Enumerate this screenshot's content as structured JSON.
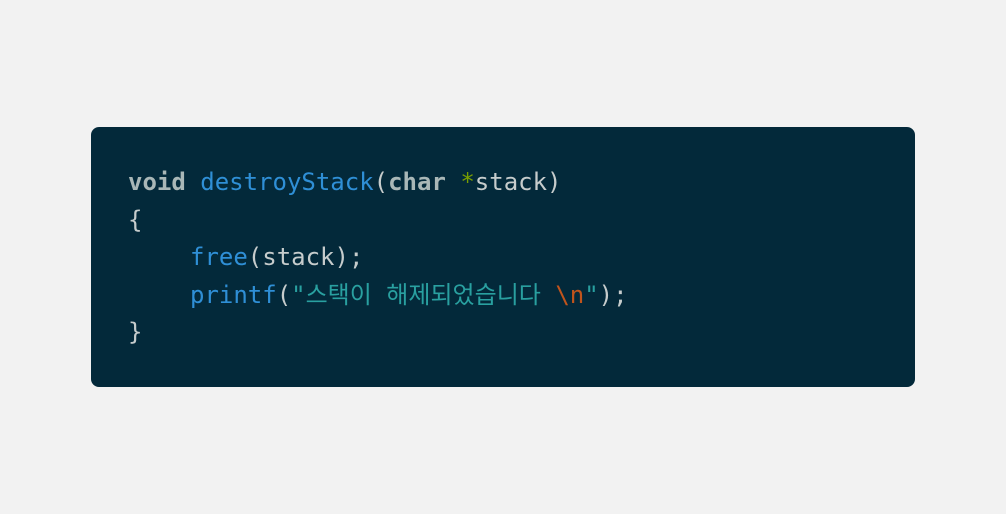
{
  "code": {
    "line1": {
      "return_type": "void",
      "function_name": "destroyStack",
      "open_paren": "(",
      "param_type": "char",
      "pointer": "*",
      "param_name": "stack",
      "close_paren": ")"
    },
    "line2": {
      "brace": "{"
    },
    "line3": {
      "call": "free",
      "rest": "(stack);"
    },
    "line4": {
      "call": "printf",
      "open": "(",
      "string_text": "\"스택이 해제되었습니다 ",
      "escape": "\\n",
      "string_close": "\"",
      "close": ");"
    },
    "line5": {
      "brace": "}"
    }
  },
  "colors": {
    "page_background": "#f2f2f2",
    "code_background": "#03293a",
    "keyword": "#a9b7b7",
    "function": "#2f8fd6",
    "plain": "#c6cccc",
    "pointer": "#7a9e00",
    "string": "#29a0a0",
    "escape": "#c1541c"
  }
}
